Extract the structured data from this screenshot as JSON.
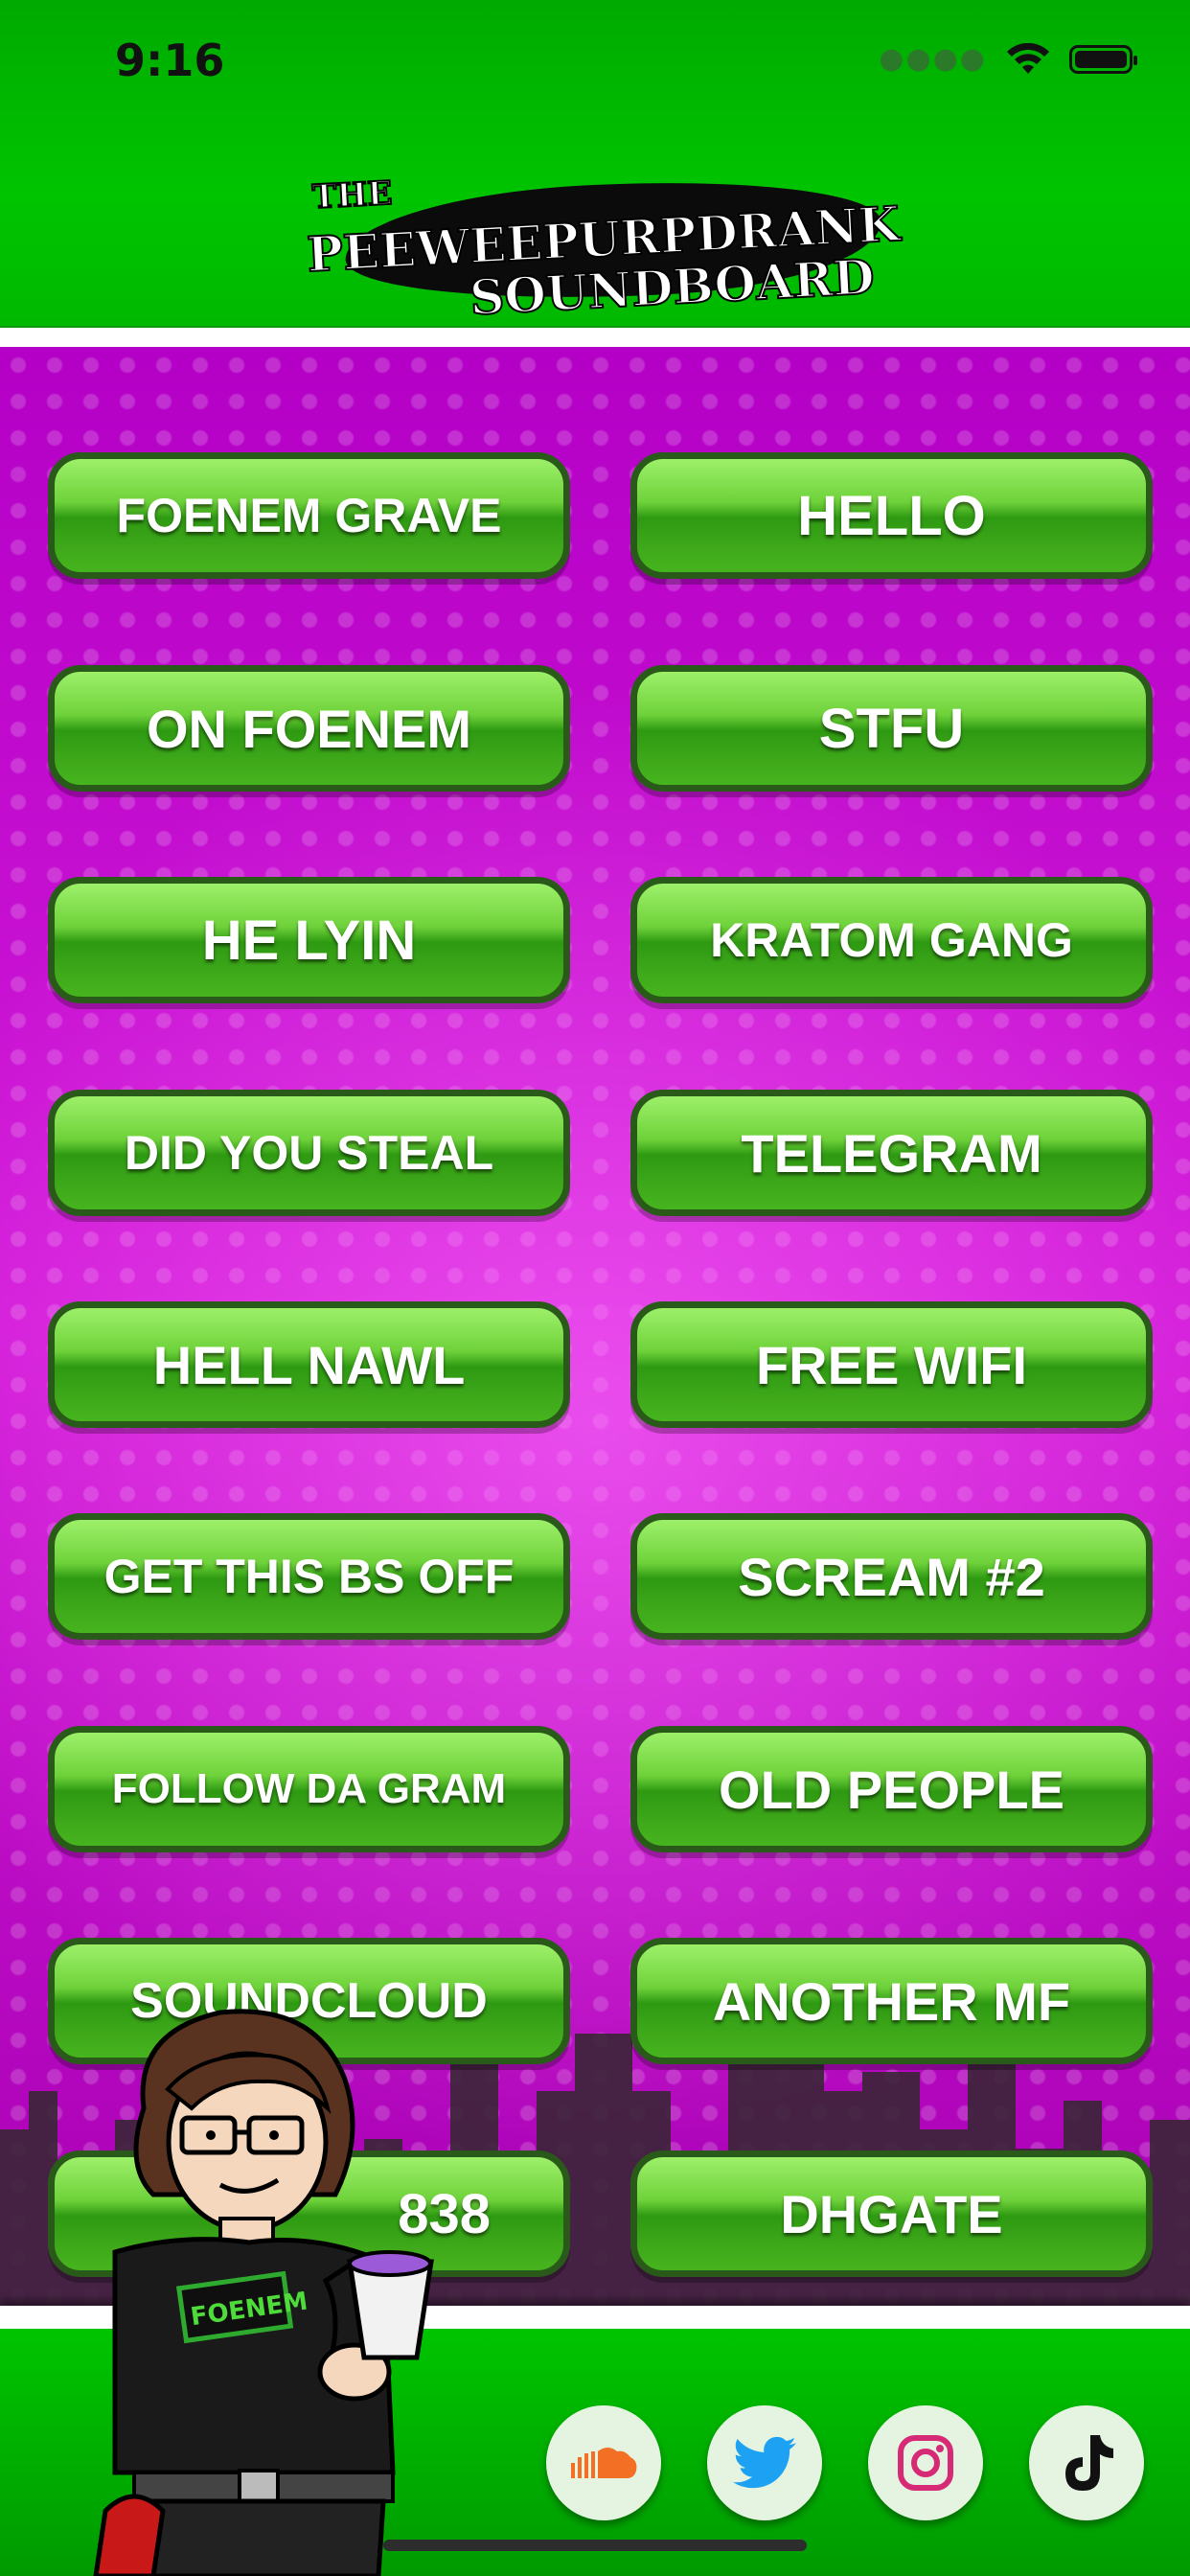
{
  "status_bar": {
    "time": "9:16"
  },
  "logo": {
    "line1": "THE",
    "line2": "PEEWEEPURPDRANK",
    "line3": "SOUNDBOARD"
  },
  "buttons": [
    "FOENEM GRAVE",
    "HELLO",
    "ON FOENEM",
    "STFU",
    "HE LYIN",
    "KRATOM GANG",
    "DID YOU STEAL",
    "TELEGRAM",
    "HELL NAWL",
    "FREE WIFI",
    "GET THIS BS OFF",
    "SCREAM #2",
    "FOLLOW DA GRAM",
    "OLD PEOPLE",
    "SOUNDCLOUD",
    "ANOTHER MF",
    "838",
    "DHGATE"
  ],
  "character": {
    "shirt_text": "FOENEM"
  },
  "social": [
    {
      "icon": "soundcloud-icon",
      "color": "#f26f23"
    },
    {
      "icon": "twitter-icon",
      "color": "#1da1f2"
    },
    {
      "icon": "instagram-icon",
      "color": "#d62976"
    },
    {
      "icon": "tiktok-icon",
      "color": "#111111"
    }
  ],
  "colors": {
    "header_green": "#00c400",
    "board_magenta": "#cc10d2",
    "button_green": "#3ea81a"
  }
}
